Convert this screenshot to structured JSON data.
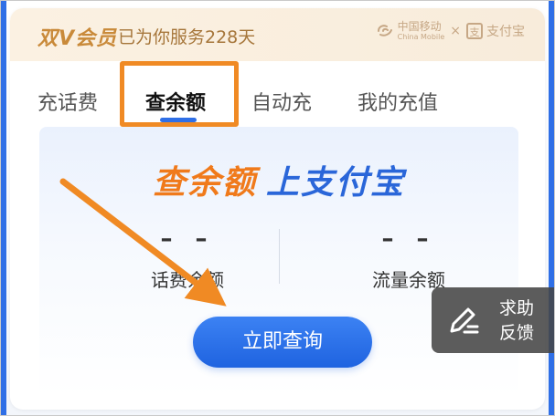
{
  "member_bar": {
    "logo_text": "双V会员",
    "served_text": "已为你服务228天",
    "china_mobile_cn": "中国移动",
    "china_mobile_en": "China Mobile",
    "times_symbol": "×",
    "alipay_mark": "支",
    "alipay_text": "支付宝"
  },
  "tabs": [
    {
      "label": "充话费",
      "active": false
    },
    {
      "label": "查余额",
      "active": true
    },
    {
      "label": "自动充",
      "active": false
    },
    {
      "label": "我的充值",
      "active": false
    }
  ],
  "panel": {
    "slogan_orange": "查余额",
    "slogan_blue": "上支付宝",
    "stats": [
      {
        "value": "– –",
        "label": "话费余额"
      },
      {
        "value": "– –",
        "label": "流量余额"
      }
    ],
    "query_button_label": "立即查询"
  },
  "help": {
    "line1": "求助",
    "line2": "反馈",
    "icon": "edit-feedback-icon"
  },
  "colors": {
    "accent_blue": "#2f6fe6",
    "highlight_orange": "#f08a24",
    "member_gold": "#c98a3a"
  }
}
